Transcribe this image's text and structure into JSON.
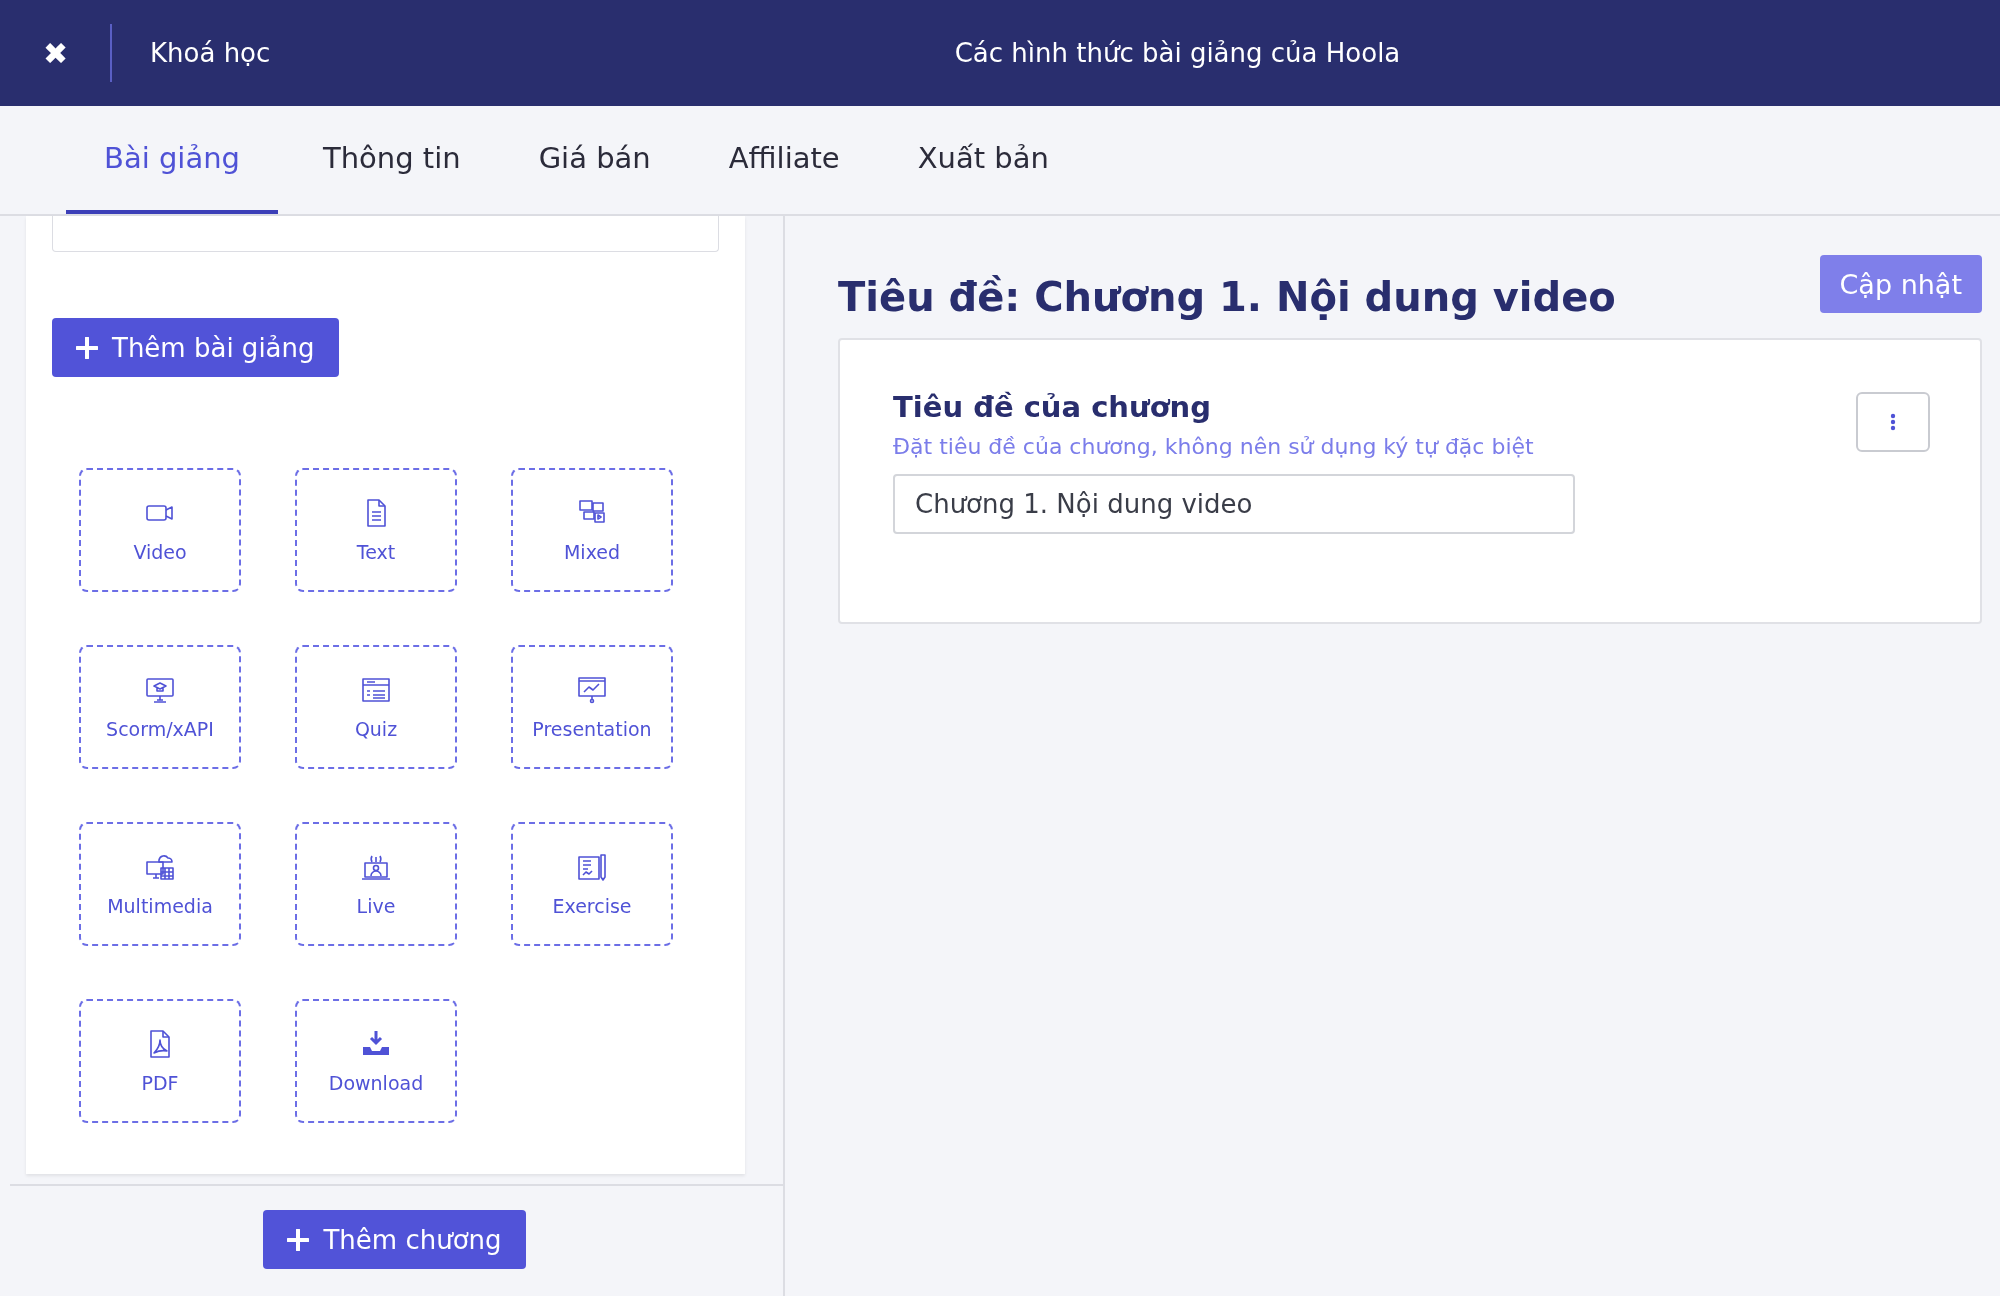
{
  "header": {
    "close": "✖",
    "back_label": "Khoá học",
    "title": "Các hình thức bài giảng của Hoola"
  },
  "tabs": [
    {
      "label": "Bài giảng",
      "selected": true
    },
    {
      "label": "Thông tin",
      "selected": false
    },
    {
      "label": "Giá bán",
      "selected": false
    },
    {
      "label": "Affiliate",
      "selected": false
    },
    {
      "label": "Xuất bản",
      "selected": false
    }
  ],
  "sidebar": {
    "add_lesson": "Thêm bài giảng",
    "lesson_types": [
      {
        "kind": "video",
        "label": "Video"
      },
      {
        "kind": "text",
        "label": "Text"
      },
      {
        "kind": "mixed",
        "label": "Mixed"
      },
      {
        "kind": "scorm",
        "label": "Scorm/xAPI"
      },
      {
        "kind": "quiz",
        "label": "Quiz"
      },
      {
        "kind": "presentation",
        "label": "Presentation"
      },
      {
        "kind": "multimedia",
        "label": "Multimedia"
      },
      {
        "kind": "live",
        "label": "Live"
      },
      {
        "kind": "exercise",
        "label": "Exercise"
      },
      {
        "kind": "pdf",
        "label": "PDF"
      },
      {
        "kind": "download",
        "label": "Download"
      }
    ],
    "add_chapter": "Thêm chương"
  },
  "editor": {
    "heading": "Tiêu đề: Chương 1. Nội dung video",
    "update_button": "Cập nhật",
    "field": {
      "label": "Tiêu đề của chương",
      "hint": "Đặt tiêu đề của chương, không nên sử dụng ký tự đặc biệt",
      "value": "Chương 1. Nội dung video"
    }
  }
}
